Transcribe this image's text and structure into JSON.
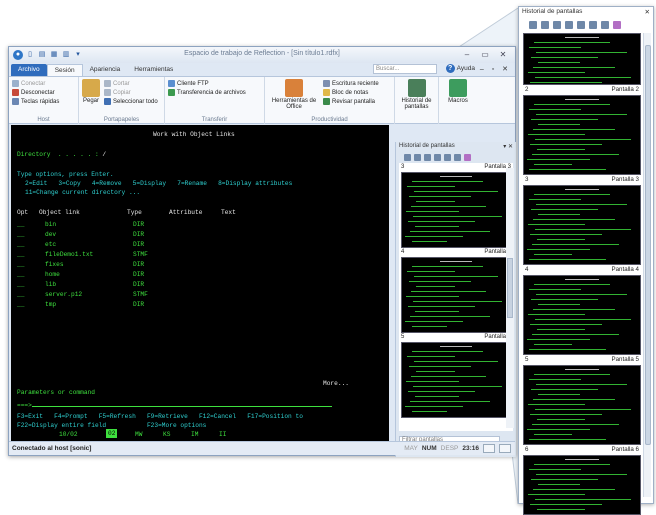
{
  "window": {
    "title": "Espacio de trabajo de Reflection - [Sin título1.rdfx]",
    "search_placeholder": "Buscar...",
    "help_label": "Ayuda"
  },
  "tabs": [
    "Archivo",
    "Sesión",
    "Apariencia",
    "Herramientas"
  ],
  "ribbon": {
    "host": {
      "label": "Host",
      "items": [
        "Conectar",
        "Desconectar",
        "Teclas rápidas"
      ]
    },
    "clipboard": {
      "label": "Portapapeles",
      "paste": "Pegar",
      "items": [
        "Cortar",
        "Copiar",
        "Seleccionar todo"
      ]
    },
    "transfer": {
      "label": "Transferir",
      "items": [
        "Cliente FTP",
        "Transferencia de archivos"
      ]
    },
    "productivity": {
      "label": "Productividad",
      "office_tools": "Herramientas de Office",
      "items": [
        "Escritura reciente",
        "Bloc de notas",
        "Revisar pantalla"
      ]
    },
    "history": {
      "label": "Historial de pantallas"
    },
    "macro": {
      "label": "Macros"
    }
  },
  "terminal": {
    "title": "Work with Object Links",
    "directory_label": "Directory  . . . . . :",
    "directory_value": "/",
    "instructions": "Type options, press Enter.",
    "options_line1": "2=Edit   3=Copy   4=Remove   5=Display   7=Rename   8=Display attributes",
    "options_line2": "11=Change current directory ...",
    "headers": [
      "Opt",
      "Object link",
      "Type",
      "Attribute",
      "Text"
    ],
    "rows": [
      {
        "opt": "__",
        "name": "bin",
        "type": "DIR"
      },
      {
        "opt": "__",
        "name": "dev",
        "type": "DIR"
      },
      {
        "opt": "__",
        "name": "etc",
        "type": "DIR"
      },
      {
        "opt": "__",
        "name": "fileDemo1.txt",
        "type": "STMF"
      },
      {
        "opt": "__",
        "name": "fixes",
        "type": "DIR"
      },
      {
        "opt": "__",
        "name": "home",
        "type": "DIR"
      },
      {
        "opt": "__",
        "name": "lib",
        "type": "DIR"
      },
      {
        "opt": "__",
        "name": "server.p12",
        "type": "STMF"
      },
      {
        "opt": "__",
        "name": "tmp",
        "type": "DIR"
      }
    ],
    "more": "More...",
    "params_label": "Parameters or command",
    "prompt": "===>",
    "fkeys_line1": "F3=Exit   F4=Prompt   F5=Refresh   F9=Retrieve   F12=Cancel   F17=Position to",
    "fkeys_line2": "F22=Display entire field           F23=More options",
    "oia": [
      "10/02",
      "MW",
      "KS",
      "IM",
      "II"
    ],
    "oia_cursor": "02"
  },
  "status": {
    "left": "Conectado al host [sonic]",
    "indicators": [
      "MAY",
      "NUM",
      "DESP"
    ],
    "clock": "23:16"
  },
  "dock_pane": {
    "title": "Historial de pantallas",
    "screens": [
      "3",
      "4",
      "5"
    ],
    "screen_labels": [
      "Pantalla 3",
      "Pantalla 4",
      "Pantalla 5"
    ],
    "filter_placeholder": "Filtrar pantallas"
  },
  "zoom_pane": {
    "title": "Historial de pantallas",
    "thumbs": [
      {
        "num": "2",
        "label": "Pantalla 2"
      },
      {
        "num": "3",
        "label": "Pantalla 3"
      },
      {
        "num": "4",
        "label": "Pantalla 4"
      },
      {
        "num": "5",
        "label": "Pantalla 5"
      },
      {
        "num": "6",
        "label": "Pantalla 6"
      }
    ]
  },
  "colors": {
    "terminal_bg": "#000000",
    "terminal_fg": "#3ee03e",
    "accent": "#2f6cbd"
  }
}
